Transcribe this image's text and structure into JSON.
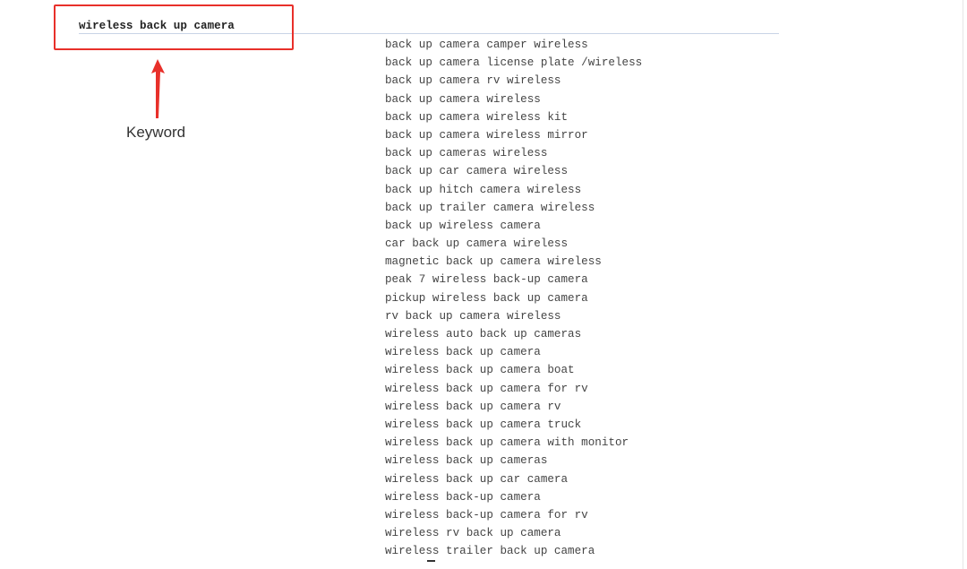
{
  "search": {
    "query": "wireless back up camera"
  },
  "annotation": {
    "label": "Keyword",
    "color": "#e8302a"
  },
  "suggestions": [
    "back up camera camper wireless",
    "back up camera license plate /wireless",
    "back up camera rv wireless",
    "back up camera wireless",
    "back up camera wireless kit",
    "back up camera wireless mirror",
    "back up cameras wireless",
    "back up car camera wireless",
    "back up hitch camera wireless",
    "back up trailer camera wireless",
    "back up wireless camera",
    "car back up camera wireless",
    "magnetic back up camera wireless",
    "peak 7 wireless back-up camera",
    "pickup wireless back up camera",
    "rv back up camera wireless",
    "wireless auto back up cameras",
    "wireless back up camera",
    "wireless back up camera boat",
    "wireless back up camera for rv",
    "wireless back up camera rv",
    "wireless back up camera truck",
    "wireless back up camera with monitor",
    "wireless back up cameras",
    "wireless back up car camera",
    "wireless back-up camera",
    "wireless back-up camera for rv",
    "wireless rv back up camera",
    "wireless trailer back up camera"
  ]
}
